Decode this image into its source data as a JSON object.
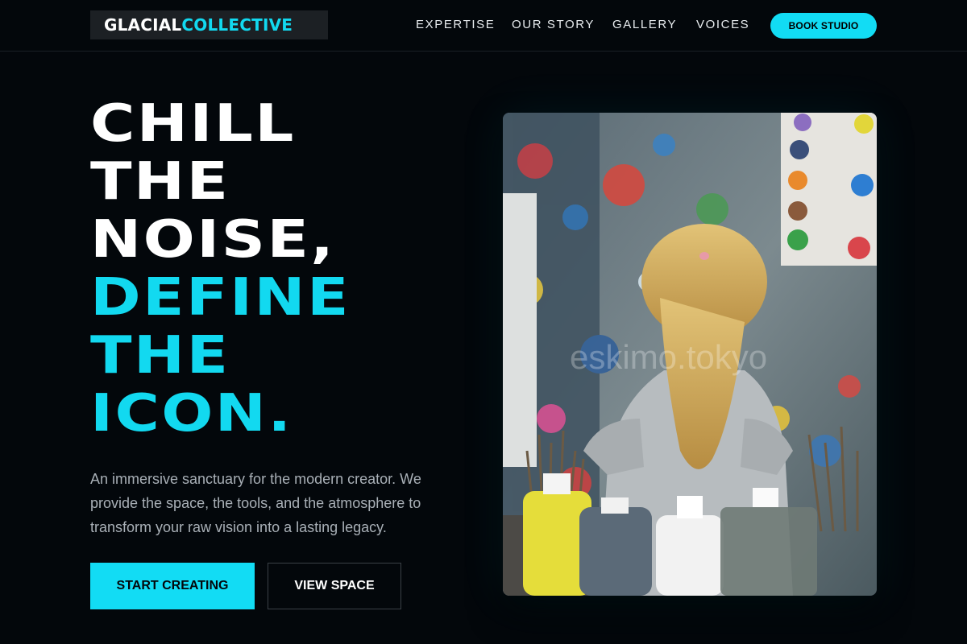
{
  "header": {
    "logo": {
      "part1": "GLACIAL",
      "part2": "COLLECTIVE"
    },
    "nav": [
      {
        "label": "EXPERTISE"
      },
      {
        "label": "OUR STORY"
      },
      {
        "label": "GALLERY"
      },
      {
        "label": "VOICES"
      }
    ],
    "cta_label": "BOOK STUDIO"
  },
  "hero": {
    "headline_white": [
      "CHILL",
      "THE",
      "NOISE,"
    ],
    "headline_cyan": [
      "DEFINE",
      "THE",
      "ICON."
    ],
    "description": "An immersive sanctuary for the modern creator. We provide the space, the tools, and the atmosphere to transform your raw vision into a lasting legacy.",
    "primary_button": "START CREATING",
    "secondary_button": "VIEW SPACE",
    "image_watermark": "eskimo.tokyo"
  },
  "colors": {
    "background": "#03070b",
    "accent": "#12dcf4",
    "text_muted": "#a9b0b7"
  }
}
